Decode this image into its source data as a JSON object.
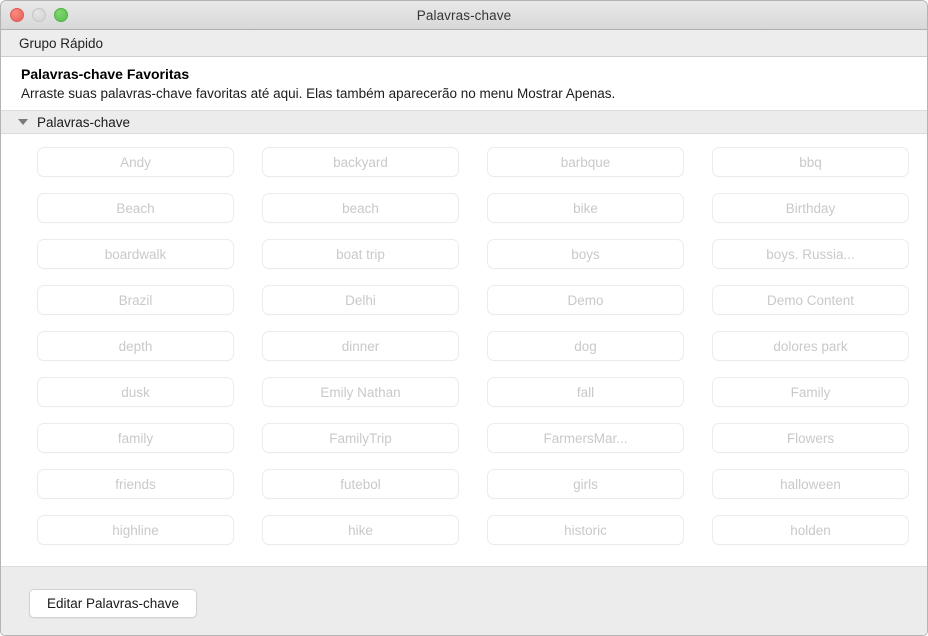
{
  "window": {
    "title": "Palavras-chave",
    "controls": [
      {
        "name": "close",
        "color": "#ec6a5f"
      },
      {
        "name": "minimize",
        "color": "#d6d6d6"
      },
      {
        "name": "zoom",
        "color": "#61c454"
      }
    ]
  },
  "toolbar": {
    "quick_group_label": "Grupo Rápido"
  },
  "favorites": {
    "title": "Palavras-chave Favoritas",
    "description": "Arraste suas palavras-chave favoritas até aqui. Elas também aparecerão no menu Mostrar Apenas."
  },
  "section": {
    "title": "Palavras-chave",
    "disclosure_icon": "triangle-down-icon",
    "expanded": true
  },
  "keywords": [
    "Andy",
    "backyard",
    "barbque",
    "bbq",
    "Beach",
    "beach",
    "bike",
    "Birthday",
    "boardwalk",
    "boat trip",
    "boys",
    "boys. Russia...",
    "Brazil",
    "Delhi",
    "Demo",
    "Demo Content",
    "depth",
    "dinner",
    "dog",
    "dolores park",
    "dusk",
    "Emily Nathan",
    "fall",
    "Family",
    "family",
    "FamilyTrip",
    "FarmersMar...",
    "Flowers",
    "friends",
    "futebol",
    "girls",
    "halloween",
    "highline",
    "hike",
    "historic",
    "holden"
  ],
  "footer": {
    "edit_button_label": "Editar Palavras-chave"
  },
  "colors": {
    "chip_text": "#c9c9c9",
    "chip_border": "#ececec",
    "header_bg": "#ececec",
    "window_bg": "#ffffff"
  }
}
